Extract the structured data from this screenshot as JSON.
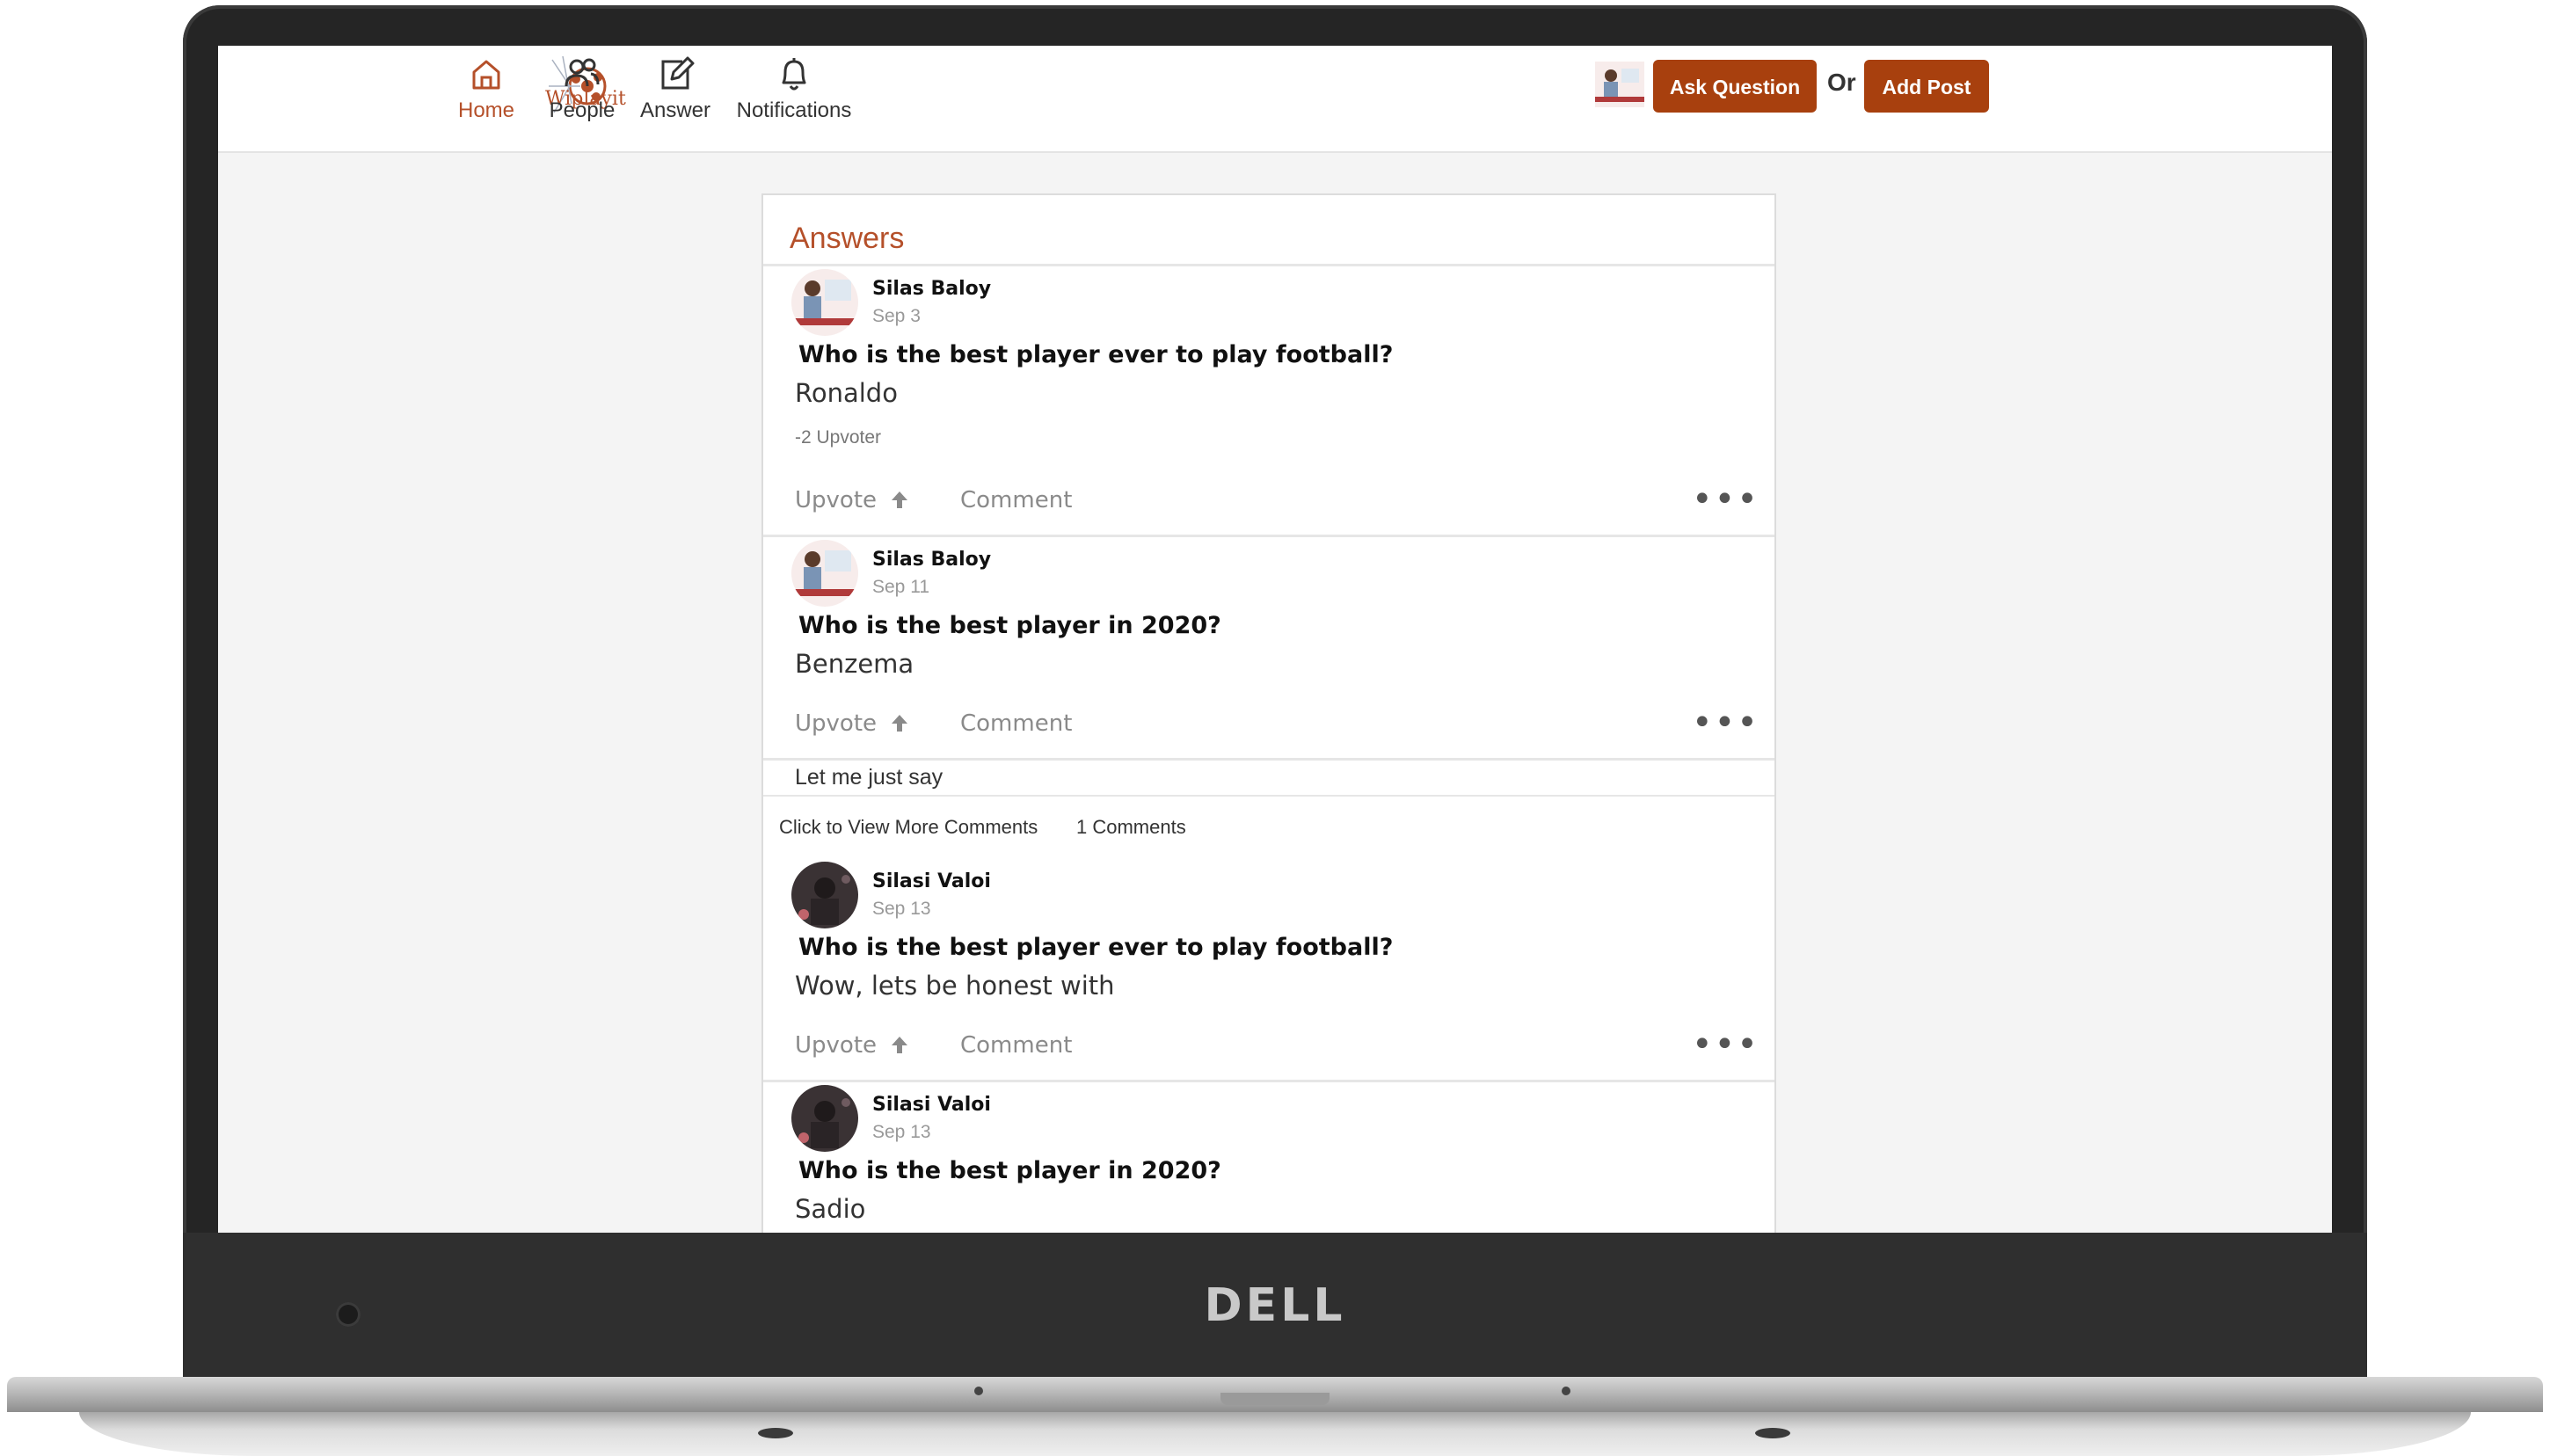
{
  "device": {
    "brand": "DELL"
  },
  "nav": {
    "logo_text": "Wiplayit",
    "items": [
      {
        "label": "Home",
        "icon": "home-icon",
        "active": true
      },
      {
        "label": "People",
        "icon": "people-icon",
        "active": false
      },
      {
        "label": "Answer",
        "icon": "edit-icon",
        "active": false
      },
      {
        "label": "Notifications",
        "icon": "bell-icon",
        "active": false
      }
    ],
    "ask_label": "Ask Question",
    "or_label": "Or",
    "add_post_label": "Add Post"
  },
  "feed": {
    "title": "Answers",
    "posts": [
      {
        "author": "Silas Baloy",
        "date": "Sep 3",
        "question": "Who is the best player ever to play football?",
        "answer": "Ronaldo",
        "votes": "-2 Upvoter",
        "upvote_label": "Upvote",
        "comment_label": "Comment"
      },
      {
        "author": "Silas Baloy",
        "date": "Sep 11",
        "question": "Who is the best player in 2020?",
        "answer": "Benzema",
        "upvote_label": "Upvote",
        "comment_label": "Comment",
        "comment_preview": "Let  me just say",
        "view_more_label": "Click to View More Comments",
        "comments_count": "1 Comments"
      },
      {
        "author": "Silasi Valoi",
        "date": "Sep 13",
        "question": "Who is the best player ever to play football?",
        "answer": "Wow, lets be honest with",
        "upvote_label": "Upvote",
        "comment_label": "Comment"
      },
      {
        "author": "Silasi Valoi",
        "date": "Sep 13",
        "question": "Who is the best player in 2020?",
        "answer": "Sadio"
      }
    ]
  },
  "colors": {
    "accent": "#b5502a",
    "button": "#a8400e",
    "bezel": "#252525",
    "page_bg": "#f4f4f4"
  }
}
